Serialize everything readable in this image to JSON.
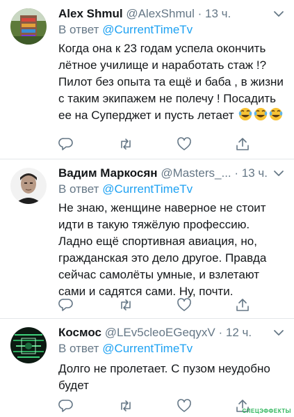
{
  "tweets": [
    {
      "name": "Alex Shmul",
      "handle": "@AlexShmul",
      "dot": "·",
      "time": "13 ч.",
      "reply_prefix": "В ответ",
      "reply_mention": "@CurrentTimeTv",
      "text": "Когда она к 23 годам успела окончить лётное училище и наработать стаж !? Пилот без опыта та ещё и баба , в жизни с таким экипажем не полечу ! Посадить ее на Суперджет и пусть летает",
      "emoji": "laughing-with-tears-emoji",
      "emoji_count": 3
    },
    {
      "name": "Вадим Маркосян",
      "handle": "@Masters_...",
      "dot": "·",
      "time": "13 ч.",
      "reply_prefix": "В ответ",
      "reply_mention": "@CurrentTimeTv",
      "text": "Не знаю, женщине наверное не стоит идти в такую тяжёлую профессию. Ладно ещё спортивная авиация, но, гражданская это дело другое. Правда сейчас самолёты умные, и взлетают сами и садятся сами. Ну, почти."
    },
    {
      "name": "Космос",
      "handle": "@LEv5cleoEGeqyxV",
      "dot": "·",
      "time": "12 ч.",
      "reply_prefix": "В ответ",
      "reply_mention": "@CurrentTimeTv",
      "text": "Долго не пролетает. С пузом неудобно будет"
    }
  ],
  "icons": {
    "reply": "reply-icon",
    "retweet": "retweet-icon",
    "like": "like-icon",
    "share": "share-icon",
    "caret": "chevron-down-icon"
  },
  "colors": {
    "text": "#14171a",
    "secondary": "#657786",
    "link": "#1da1f2",
    "divider": "#e3e7ea",
    "watermark": "#2bb55a"
  },
  "watermark": "СПЕЦЭФФЕКТЫ"
}
